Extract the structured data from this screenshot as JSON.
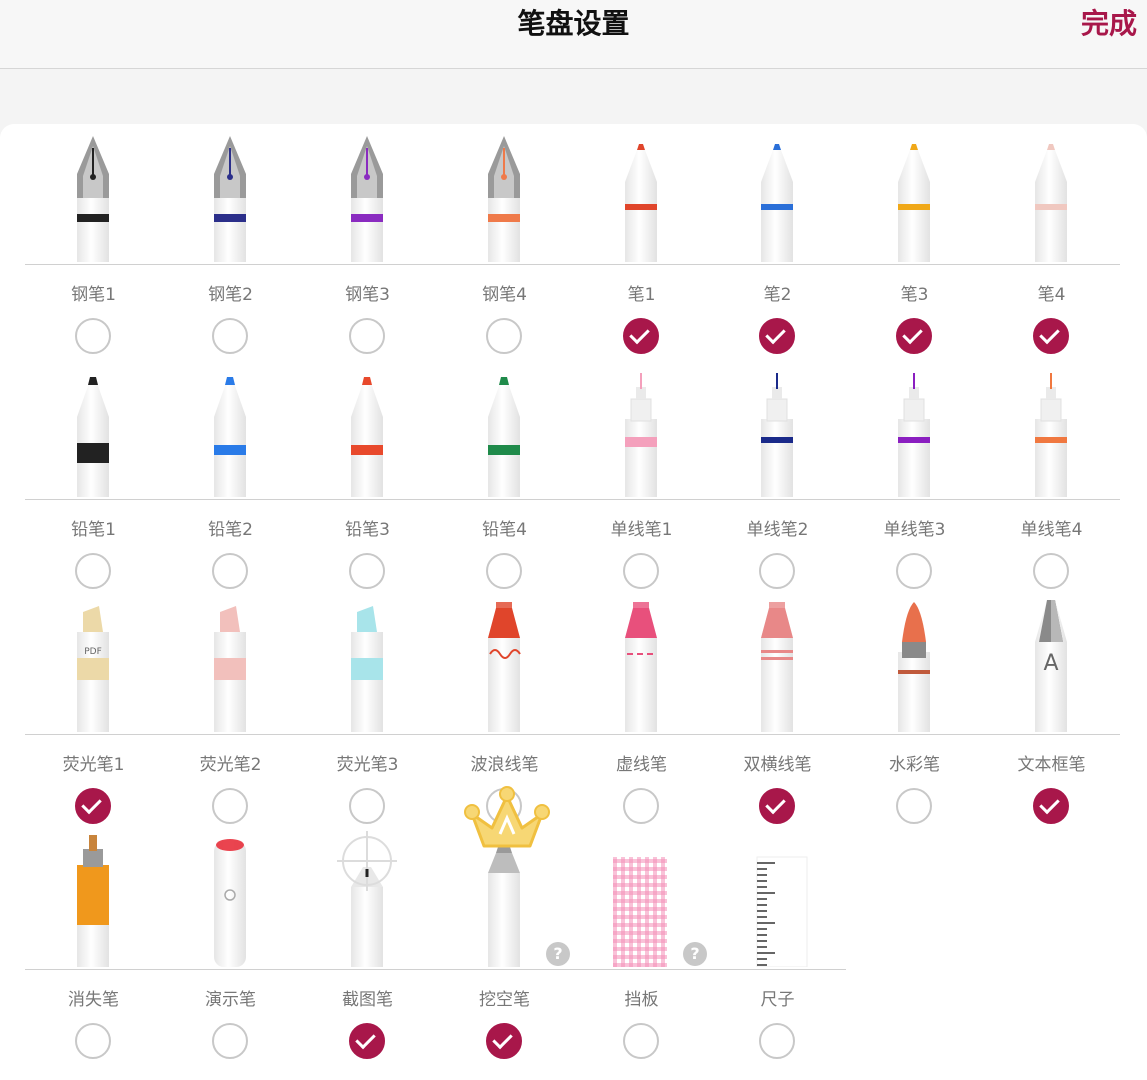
{
  "header": {
    "title": "笔盘设置",
    "done_label": "完成"
  },
  "accent_color": "#a8174a",
  "rows": [
    [
      {
        "label": "钢笔1",
        "type": "fountain",
        "color": "#222222",
        "checked": false
      },
      {
        "label": "钢笔2",
        "type": "fountain",
        "color": "#2b2f8a",
        "checked": false
      },
      {
        "label": "钢笔3",
        "type": "fountain",
        "color": "#8a2bc0",
        "checked": false
      },
      {
        "label": "钢笔4",
        "type": "fountain",
        "color": "#ef7a4a",
        "checked": false
      },
      {
        "label": "笔1",
        "type": "pen",
        "color": "#e0452b",
        "checked": true
      },
      {
        "label": "笔2",
        "type": "pen",
        "color": "#2a6fd8",
        "checked": true
      },
      {
        "label": "笔3",
        "type": "pen",
        "color": "#f0a818",
        "checked": true
      },
      {
        "label": "笔4",
        "type": "pen",
        "color": "#f0c8c0",
        "checked": true
      }
    ],
    [
      {
        "label": "铅笔1",
        "type": "pencil",
        "color": "#222222",
        "checked": false
      },
      {
        "label": "铅笔2",
        "type": "pencil",
        "color": "#2a7be8",
        "checked": false
      },
      {
        "label": "铅笔3",
        "type": "pencil",
        "color": "#e8492c",
        "checked": false
      },
      {
        "label": "铅笔4",
        "type": "pencil",
        "color": "#1f8a4a",
        "checked": false
      },
      {
        "label": "单线笔1",
        "type": "fineliner",
        "color": "#f4a0bc",
        "checked": false
      },
      {
        "label": "单线笔2",
        "type": "fineliner",
        "color": "#1a2a8a",
        "checked": false
      },
      {
        "label": "单线笔3",
        "type": "fineliner",
        "color": "#8a1ec0",
        "checked": false
      },
      {
        "label": "单线笔4",
        "type": "fineliner",
        "color": "#f07840",
        "checked": false
      }
    ],
    [
      {
        "label": "荧光笔1",
        "type": "highlighter",
        "color": "#ecd9a8",
        "checked": true,
        "text": "PDF"
      },
      {
        "label": "荧光笔2",
        "type": "highlighter",
        "color": "#f2c0bc",
        "checked": false
      },
      {
        "label": "荧光笔3",
        "type": "highlighter",
        "color": "#a8e4ea",
        "checked": false
      },
      {
        "label": "波浪线笔",
        "type": "marker-wave",
        "color": "#e0452b",
        "checked": false
      },
      {
        "label": "虚线笔",
        "type": "marker-dash",
        "color": "#e8507c",
        "checked": false
      },
      {
        "label": "双横线笔",
        "type": "marker-double",
        "color": "#e88888",
        "checked": true
      },
      {
        "label": "水彩笔",
        "type": "watercolor",
        "color": "#e8704c",
        "checked": false
      },
      {
        "label": "文本框笔",
        "type": "textbox",
        "color": "#888888",
        "checked": true,
        "text": "A"
      }
    ],
    [
      {
        "label": "消失笔",
        "type": "vanish",
        "color": "#f0981c",
        "checked": false
      },
      {
        "label": "演示笔",
        "type": "laser",
        "color": "#e8303c",
        "checked": false
      },
      {
        "label": "截图笔",
        "type": "screenshot",
        "color": "#222222",
        "checked": true
      },
      {
        "label": "挖空笔",
        "type": "hollow",
        "color": "#999999",
        "checked": true
      },
      {
        "label": "挡板",
        "type": "shield",
        "color": "#f490b8",
        "checked": false
      },
      {
        "label": "尺子",
        "type": "ruler",
        "color": "#333333",
        "checked": false
      }
    ]
  ],
  "help_badge": "?"
}
